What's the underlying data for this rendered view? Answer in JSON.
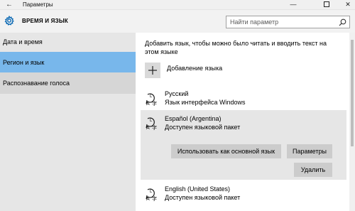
{
  "window": {
    "title": "Параметры",
    "back_glyph": "←",
    "minimize_glyph": "—",
    "close_glyph": "✕"
  },
  "header": {
    "section_title": "ВРЕМЯ И ЯЗЫК",
    "icon": "gear-icon"
  },
  "search": {
    "placeholder": "Найти параметр",
    "icon": "search-icon"
  },
  "sidebar": {
    "items": [
      {
        "label": "Дата и время",
        "selected": false
      },
      {
        "label": "Регион и язык",
        "selected": true
      },
      {
        "label": "Распознавание голоса",
        "selected": false
      }
    ]
  },
  "main": {
    "intro": "Добавить язык, чтобы можно было читать и вводить текст на этом языке",
    "add_language_label": "Добавление языка",
    "add_language_icon": "plus-icon",
    "languages": [
      {
        "name": "Русский",
        "status": "Язык интерфейса Windows",
        "icon": "language-icon"
      },
      {
        "name": "Español (Argentina)",
        "status": "Доступен языковой пакет",
        "icon": "language-icon",
        "expanded": true
      },
      {
        "name": "English (United States)",
        "status": "Доступен языковой пакет",
        "icon": "language-icon"
      }
    ],
    "actions": {
      "set_default": "Использовать как основной язык",
      "options": "Параметры",
      "remove": "Удалить"
    }
  },
  "colors": {
    "accent": "#0063b1",
    "selected_nav": "#78b7eb",
    "sidebar_bg": "#e6e6e6",
    "button_bg": "#cccccc"
  }
}
